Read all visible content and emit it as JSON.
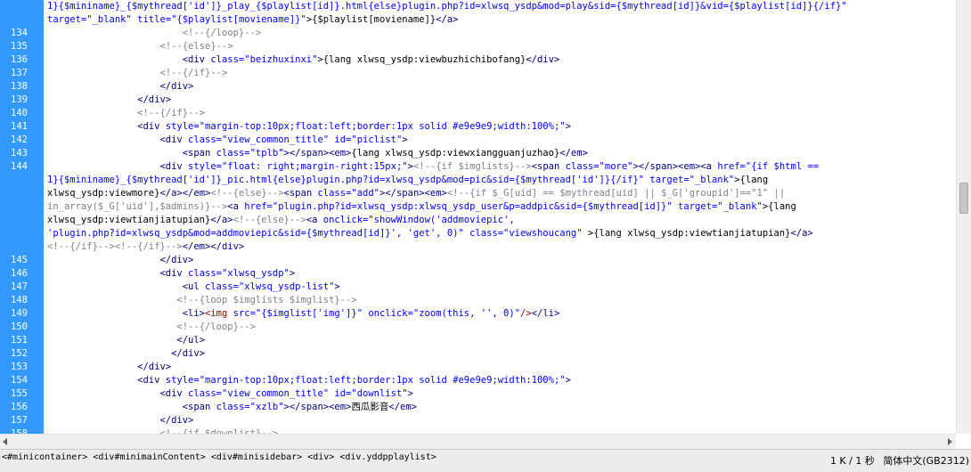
{
  "lines": [
    {
      "num": "",
      "tokens": [
        {
          "t": "1}{$mininame}_{$mythread['id']}_play_{$playlist[id]}.html{else}plugin.php?id=xlwsq_ysdp&mod=play&sid={$mythread[id]}&vid={$playlist[id]}{/if}\"",
          "c": "tk-str"
        }
      ]
    },
    {
      "num": "",
      "tokens": [
        {
          "t": "target=\"_blank\" ",
          "c": "tk-str"
        },
        {
          "t": "title=\"{$playlist[moviename]}\"",
          "c": "tk-str"
        },
        {
          "t": ">{$playlist[moviename]}",
          "c": "tk-txt"
        },
        {
          "t": "</a>",
          "c": "tk-tag"
        }
      ]
    },
    {
      "num": "134",
      "tokens": [
        {
          "t": "                        ",
          "c": "tk-txt"
        },
        {
          "t": "<!--{/loop}-->",
          "c": "tk-cmt"
        }
      ]
    },
    {
      "num": "135",
      "tokens": [
        {
          "t": "                    ",
          "c": "tk-txt"
        },
        {
          "t": "<!--{else}-->",
          "c": "tk-cmt"
        }
      ]
    },
    {
      "num": "136",
      "tokens": [
        {
          "t": "                        ",
          "c": "tk-txt"
        },
        {
          "t": "<div ",
          "c": "tk-tag"
        },
        {
          "t": "class=\"beizhuxinxi\"",
          "c": "tk-str"
        },
        {
          "t": ">{lang xlwsq_ysdp:viewbuzhichibofang}",
          "c": "tk-txt"
        },
        {
          "t": "</div>",
          "c": "tk-tag"
        }
      ]
    },
    {
      "num": "137",
      "tokens": [
        {
          "t": "                    ",
          "c": "tk-txt"
        },
        {
          "t": "<!--{/if}-->",
          "c": "tk-cmt"
        }
      ]
    },
    {
      "num": "138",
      "tokens": [
        {
          "t": "                    ",
          "c": "tk-txt"
        },
        {
          "t": "</div>",
          "c": "tk-tag"
        }
      ]
    },
    {
      "num": "139",
      "tokens": [
        {
          "t": "                ",
          "c": "tk-txt"
        },
        {
          "t": "</div>",
          "c": "tk-tag"
        }
      ]
    },
    {
      "num": "140",
      "tokens": [
        {
          "t": "                ",
          "c": "tk-txt"
        },
        {
          "t": "<!--{/if}-->",
          "c": "tk-cmt"
        }
      ]
    },
    {
      "num": "141",
      "tokens": [
        {
          "t": "                ",
          "c": "tk-txt"
        },
        {
          "t": "<div ",
          "c": "tk-tag"
        },
        {
          "t": "style=\"margin-top:10px;float:left;border:1px solid #e9e9e9;width:100%;\"",
          "c": "tk-str"
        },
        {
          "t": ">",
          "c": "tk-tag"
        }
      ]
    },
    {
      "num": "142",
      "tokens": [
        {
          "t": "                    ",
          "c": "tk-txt"
        },
        {
          "t": "<div ",
          "c": "tk-tag"
        },
        {
          "t": "class=\"view_common_title\" id=\"piclist\"",
          "c": "tk-str"
        },
        {
          "t": ">",
          "c": "tk-tag"
        }
      ]
    },
    {
      "num": "143",
      "tokens": [
        {
          "t": "                        ",
          "c": "tk-txt"
        },
        {
          "t": "<span ",
          "c": "tk-tag"
        },
        {
          "t": "class=\"tplb\"",
          "c": "tk-str"
        },
        {
          "t": "></span><em>",
          "c": "tk-tag"
        },
        {
          "t": "{lang xlwsq_ysdp:viewxiangguanjuzhao}",
          "c": "tk-txt"
        },
        {
          "t": "</em>",
          "c": "tk-tag"
        }
      ]
    },
    {
      "num": "144",
      "tokens": [
        {
          "t": "                    ",
          "c": "tk-txt"
        },
        {
          "t": "<div ",
          "c": "tk-tag"
        },
        {
          "t": "style=\"float: right;margin-right:15px;\"",
          "c": "tk-str"
        },
        {
          "t": ">",
          "c": "tk-tag"
        },
        {
          "t": "<!--{if $imglists}-->",
          "c": "tk-cmt"
        },
        {
          "t": "<span ",
          "c": "tk-tag"
        },
        {
          "t": "class=\"more\"",
          "c": "tk-str"
        },
        {
          "t": "></span><em><a ",
          "c": "tk-tag"
        },
        {
          "t": "href=\"{if $html ==",
          "c": "tk-str"
        }
      ]
    },
    {
      "num": "",
      "tokens": [
        {
          "t": "1}{$mininame}_{$mythread['id']}_pic.html{else}plugin.php?id=xlwsq_ysdp&mod=pic&sid={$mythread['id']}{/if}\" target=\"_blank\"",
          "c": "tk-str"
        },
        {
          "t": ">{lang",
          "c": "tk-txt"
        }
      ]
    },
    {
      "num": "",
      "tokens": [
        {
          "t": "xlwsq_ysdp:viewmore}",
          "c": "tk-txt"
        },
        {
          "t": "</a></em>",
          "c": "tk-tag"
        },
        {
          "t": "<!--{else}-->",
          "c": "tk-cmt"
        },
        {
          "t": "<span ",
          "c": "tk-tag"
        },
        {
          "t": "class=\"add\"",
          "c": "tk-str"
        },
        {
          "t": "></span><em>",
          "c": "tk-tag"
        },
        {
          "t": "<!--{if $_G[uid] == $mythread[uid] || $_G['groupid']==\"1\" ||",
          "c": "tk-cmt"
        }
      ]
    },
    {
      "num": "",
      "tokens": [
        {
          "t": "in_array($_G['uid'],$admins)}-->",
          "c": "tk-cmt"
        },
        {
          "t": "<a ",
          "c": "tk-tag"
        },
        {
          "t": "href=\"plugin.php?id=xlwsq_ysdp:xlwsq_ysdp_user&p=addpic&sid={$mythread[id]}\" target=\"_blank\"",
          "c": "tk-str"
        },
        {
          "t": ">{lang",
          "c": "tk-txt"
        }
      ]
    },
    {
      "num": "",
      "tokens": [
        {
          "t": "xlwsq_ysdp:viewtianjiatupian}",
          "c": "tk-txt"
        },
        {
          "t": "</a>",
          "c": "tk-tag"
        },
        {
          "t": "<!--{else}-->",
          "c": "tk-cmt"
        },
        {
          "t": "<a ",
          "c": "tk-tag"
        },
        {
          "t": "onclick=\"showWindow('addmoviepic',",
          "c": "tk-str"
        }
      ]
    },
    {
      "num": "",
      "tokens": [
        {
          "t": "'plugin.php?id=xlwsq_ysdp&mod=addmoviepic&sid={$mythread[id]}', 'get', 0)\" class=\"viewshoucang\" ",
          "c": "tk-str"
        },
        {
          "t": ">{lang xlwsq_ysdp:viewtianjiatupian}",
          "c": "tk-txt"
        },
        {
          "t": "</a>",
          "c": "tk-tag"
        }
      ]
    },
    {
      "num": "",
      "tokens": [
        {
          "t": "<!--{/if}--><!--{/if}-->",
          "c": "tk-cmt"
        },
        {
          "t": "</em></div>",
          "c": "tk-tag"
        }
      ]
    },
    {
      "num": "145",
      "tokens": [
        {
          "t": "                    ",
          "c": "tk-txt"
        },
        {
          "t": "</div>",
          "c": "tk-tag"
        }
      ]
    },
    {
      "num": "146",
      "tokens": [
        {
          "t": "                    ",
          "c": "tk-txt"
        },
        {
          "t": "<div ",
          "c": "tk-tag"
        },
        {
          "t": "class=\"xlwsq_ysdp\"",
          "c": "tk-str"
        },
        {
          "t": ">",
          "c": "tk-tag"
        }
      ]
    },
    {
      "num": "147",
      "tokens": [
        {
          "t": "                        ",
          "c": "tk-txt"
        },
        {
          "t": "<ul ",
          "c": "tk-tag"
        },
        {
          "t": "class=\"xlwsq_ysdp-list\"",
          "c": "tk-str"
        },
        {
          "t": ">",
          "c": "tk-tag"
        }
      ]
    },
    {
      "num": "148",
      "tokens": [
        {
          "t": "                       ",
          "c": "tk-txt"
        },
        {
          "t": "<!--{loop $imglists $imglist}-->",
          "c": "tk-cmt"
        }
      ]
    },
    {
      "num": "149",
      "tokens": [
        {
          "t": "                        ",
          "c": "tk-txt"
        },
        {
          "t": "<li>",
          "c": "tk-tag"
        },
        {
          "t": "<img ",
          "c": "tk-red"
        },
        {
          "t": "src=\"{$imglist['img']}\" onclick=\"zoom(this, '', 0)\"",
          "c": "tk-str"
        },
        {
          "t": "/>",
          "c": "tk-red"
        },
        {
          "t": "</li>",
          "c": "tk-tag"
        }
      ]
    },
    {
      "num": "150",
      "tokens": [
        {
          "t": "                       ",
          "c": "tk-txt"
        },
        {
          "t": "<!--{/loop}-->",
          "c": "tk-cmt"
        }
      ]
    },
    {
      "num": "151",
      "tokens": [
        {
          "t": "                       ",
          "c": "tk-txt"
        },
        {
          "t": "</ul>",
          "c": "tk-tag"
        }
      ]
    },
    {
      "num": "152",
      "tokens": [
        {
          "t": "                      ",
          "c": "tk-txt"
        },
        {
          "t": "</div>",
          "c": "tk-tag"
        }
      ]
    },
    {
      "num": "153",
      "tokens": [
        {
          "t": "                ",
          "c": "tk-txt"
        },
        {
          "t": "</div>",
          "c": "tk-tag"
        }
      ]
    },
    {
      "num": "154",
      "tokens": [
        {
          "t": "                ",
          "c": "tk-txt"
        },
        {
          "t": "<div ",
          "c": "tk-tag"
        },
        {
          "t": "style=\"margin-top:10px;float:left;border:1px solid #e9e9e9;width:100%;\"",
          "c": "tk-str"
        },
        {
          "t": ">",
          "c": "tk-tag"
        }
      ]
    },
    {
      "num": "155",
      "tokens": [
        {
          "t": "                    ",
          "c": "tk-txt"
        },
        {
          "t": "<div ",
          "c": "tk-tag"
        },
        {
          "t": "class=\"view_common_title\" id=\"downlist\"",
          "c": "tk-str"
        },
        {
          "t": ">",
          "c": "tk-tag"
        }
      ]
    },
    {
      "num": "156",
      "tokens": [
        {
          "t": "                        ",
          "c": "tk-txt"
        },
        {
          "t": "<span ",
          "c": "tk-tag"
        },
        {
          "t": "class=\"xzlb\"",
          "c": "tk-str"
        },
        {
          "t": "></span><em>",
          "c": "tk-tag"
        },
        {
          "t": "西瓜影音",
          "c": "tk-txt"
        },
        {
          "t": "</em>",
          "c": "tk-tag"
        }
      ]
    },
    {
      "num": "157",
      "tokens": [
        {
          "t": "                    ",
          "c": "tk-txt"
        },
        {
          "t": "</div>",
          "c": "tk-tag"
        }
      ]
    },
    {
      "num": "158",
      "tokens": [
        {
          "t": "                    ",
          "c": "tk-txt"
        },
        {
          "t": "<!--{if $downlist}-->",
          "c": "tk-cmt"
        }
      ]
    }
  ],
  "breadcrumb": [
    "<#minicontainer>",
    "<div#minimainContent>",
    "<div#minisidebar>",
    "<div>",
    "<div.yddpplaylist>"
  ],
  "status": {
    "size": "1 K / 1 秒",
    "encoding": "简体中文(GB2312)"
  },
  "colors": {
    "gutter": "#3399ff",
    "tag": "#000080",
    "string": "#0000ff",
    "comment": "#808080"
  },
  "icons": {
    "scroll_left": "triangle-left-icon",
    "scroll_right": "triangle-right-icon"
  }
}
